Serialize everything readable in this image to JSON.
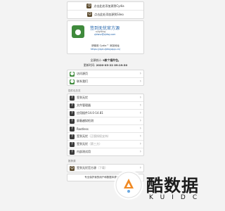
{
  "top_links": [
    {
      "label": "点击此处添加源到Cydia"
    },
    {
      "label": "点击此处添加源到Sileo"
    }
  ],
  "repo": {
    "title": "签到无忧官方源",
    "maintainer": "suiyixing",
    "email": "zjdwvz@zjdwy.com",
    "description": "请使用 Cydia™ 添加地址",
    "url": "https://apt.zjdwyapp.cn/"
  },
  "info": {
    "total_label": "全源统计:",
    "total_value": "9款个插件包。",
    "updated_label": "更新时间:",
    "updated_value": "2020-03-22 09:19:30"
  },
  "links": [
    {
      "label": "访问源页",
      "icon": "green-app-icon"
    },
    {
      "label": "联系我们",
      "icon": "green-app-icon"
    }
  ],
  "section_title": "插件包总览",
  "packages": [
    {
      "label": "签到无忧",
      "muted": ""
    },
    {
      "label": "文件管理器",
      "muted": ""
    },
    {
      "label": "应用插件14.0-14.81",
      "muted": ""
    },
    {
      "label": "屏蔽越狱检测",
      "muted": ""
    },
    {
      "label": "Rootless",
      "muted": ""
    },
    {
      "label": "签到无忧",
      "muted": "（正版授权支持）"
    },
    {
      "label": "签到无忧",
      "muted": "（第三方）"
    },
    {
      "label": "内部测试用",
      "muted": ""
    }
  ],
  "section_title_2": "推荐源",
  "featured": {
    "label": "签到无忧官方源",
    "muted": "（下载）"
  },
  "footer_note": "专业保护我的用户和数据本源官方出品",
  "watermark": {
    "text": "酷数据",
    "sub": "KUIDC"
  }
}
